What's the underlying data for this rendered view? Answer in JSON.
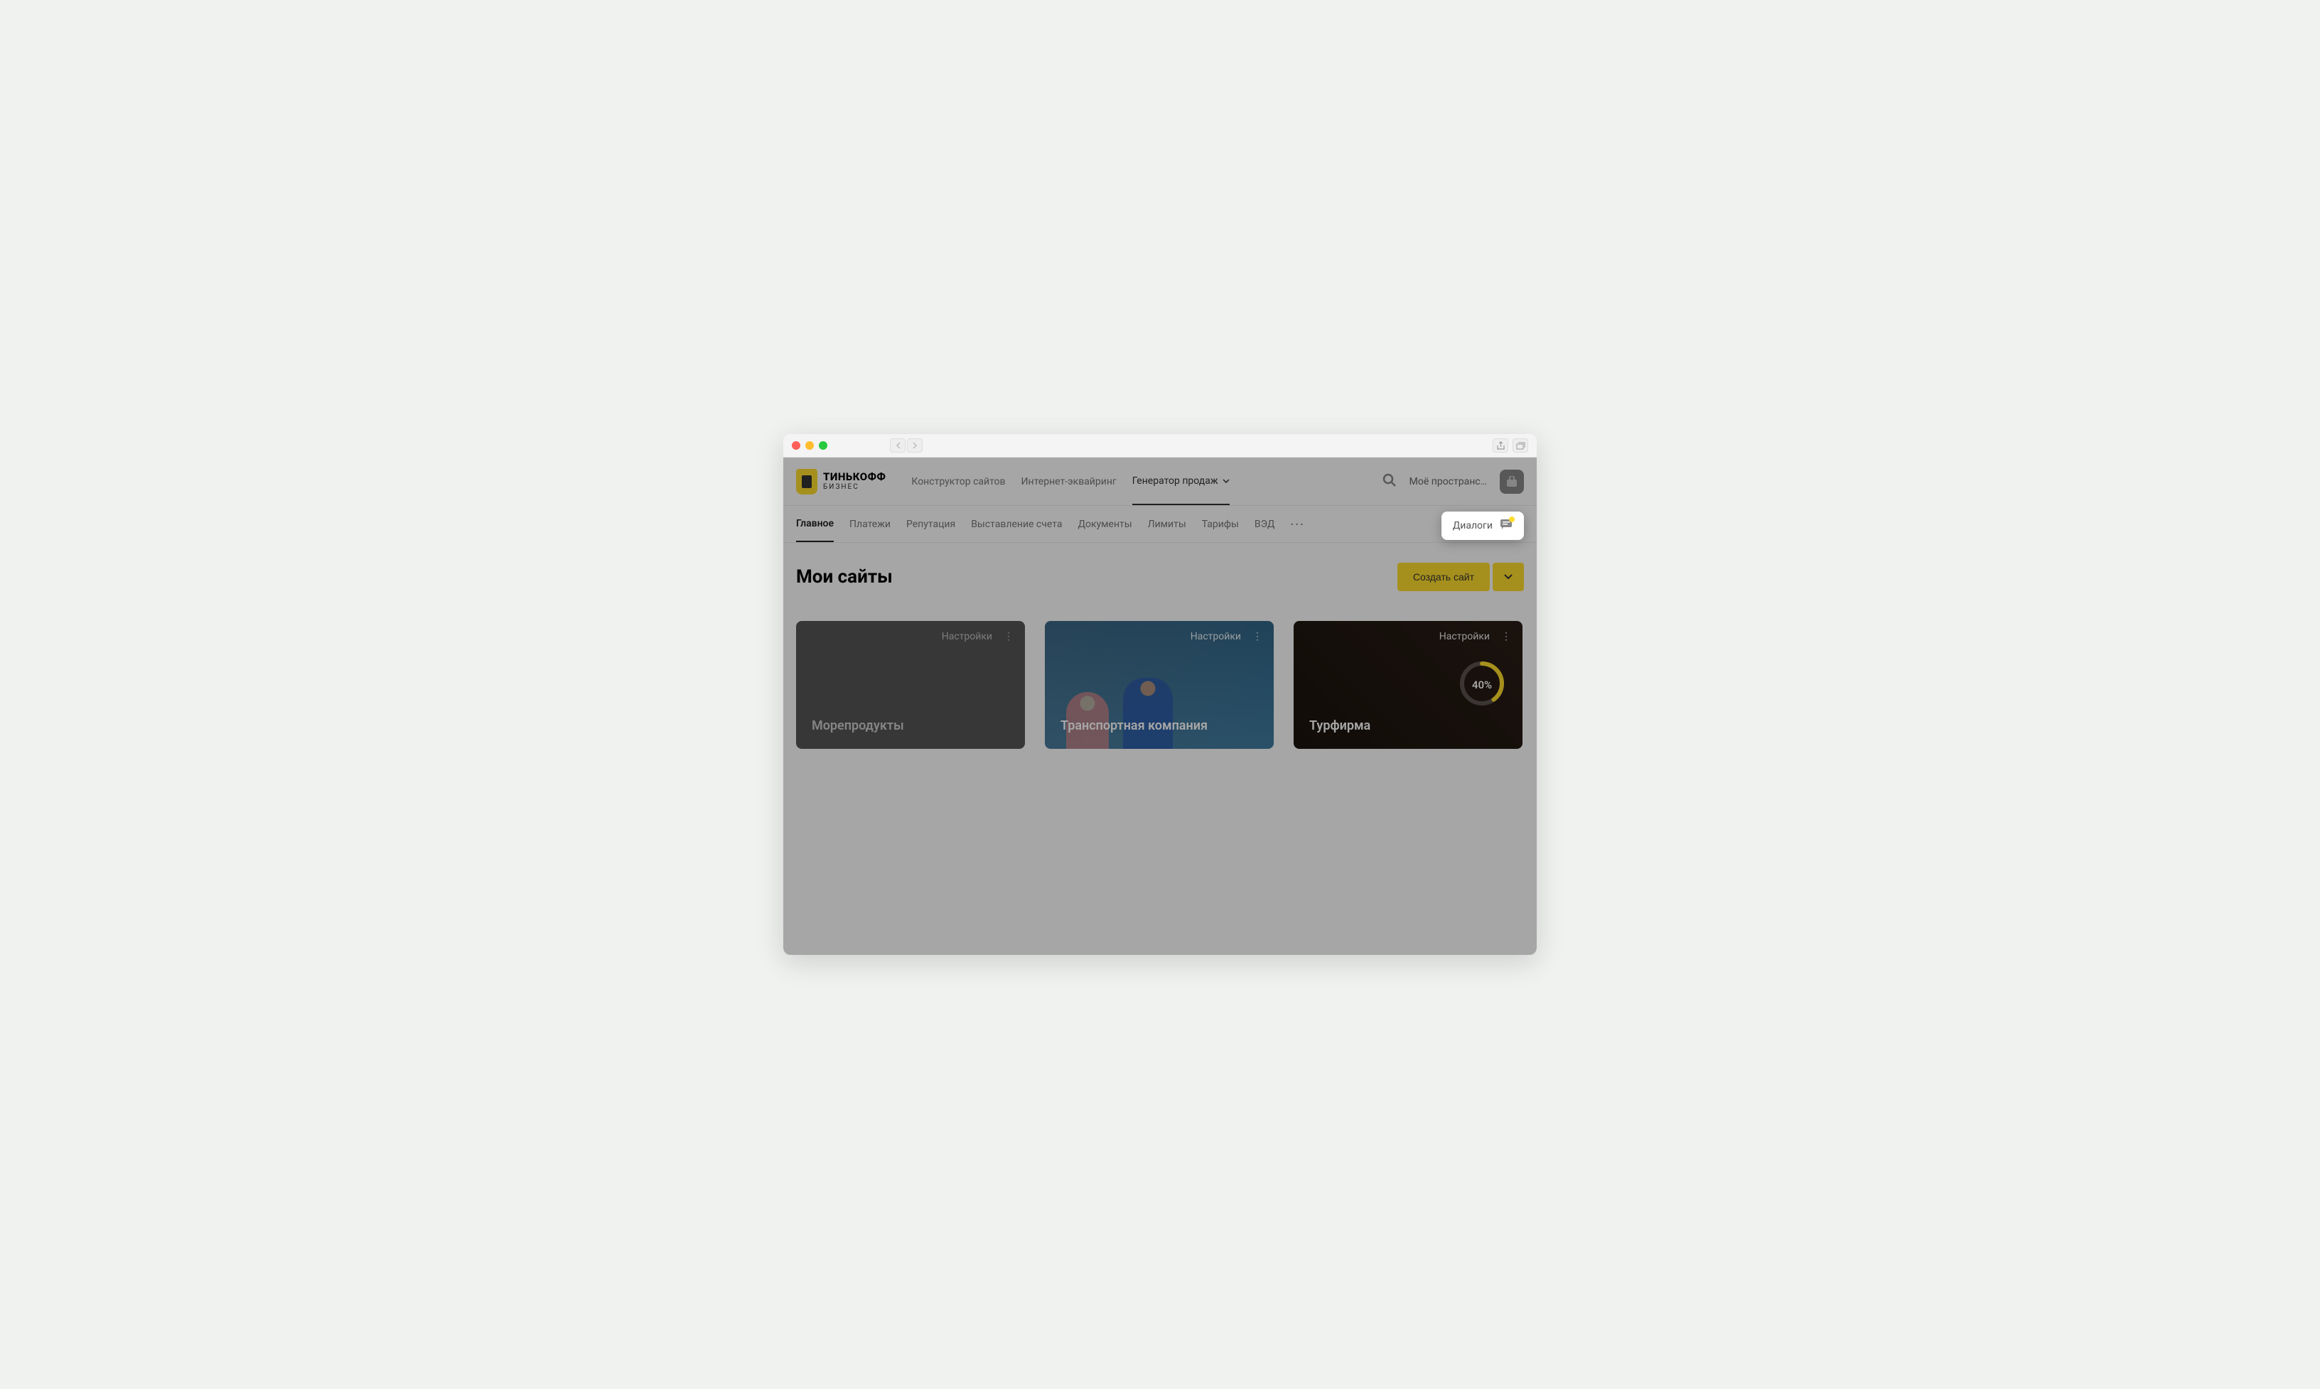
{
  "logo": {
    "main": "ТИНЬКОФФ",
    "sub": "БИЗНЕС"
  },
  "topnav": {
    "items": [
      {
        "label": "Конструктор сайтов",
        "active": false
      },
      {
        "label": "Интернет-эквайринг",
        "active": false
      },
      {
        "label": "Генератор продаж",
        "active": true
      }
    ],
    "workspace": "Моё пространс…"
  },
  "subnav": {
    "items": [
      {
        "label": "Главное",
        "active": true
      },
      {
        "label": "Платежи",
        "active": false
      },
      {
        "label": "Репутация",
        "active": false
      },
      {
        "label": "Выставление счета",
        "active": false
      },
      {
        "label": "Документы",
        "active": false
      },
      {
        "label": "Лимиты",
        "active": false
      },
      {
        "label": "Тарифы",
        "active": false
      },
      {
        "label": "ВЭД",
        "active": false
      }
    ]
  },
  "dialogs_label": "Диалоги",
  "page_title": "Мои сайты",
  "create_label": "Создать сайт",
  "card_settings_label": "Настройки",
  "cards": [
    {
      "title": "Морепродукты",
      "kind": "dark"
    },
    {
      "title": "Транспортная компания",
      "kind": "img1"
    },
    {
      "title": "Турфирма",
      "kind": "img2",
      "progress": 40,
      "progress_label": "40%"
    }
  ]
}
